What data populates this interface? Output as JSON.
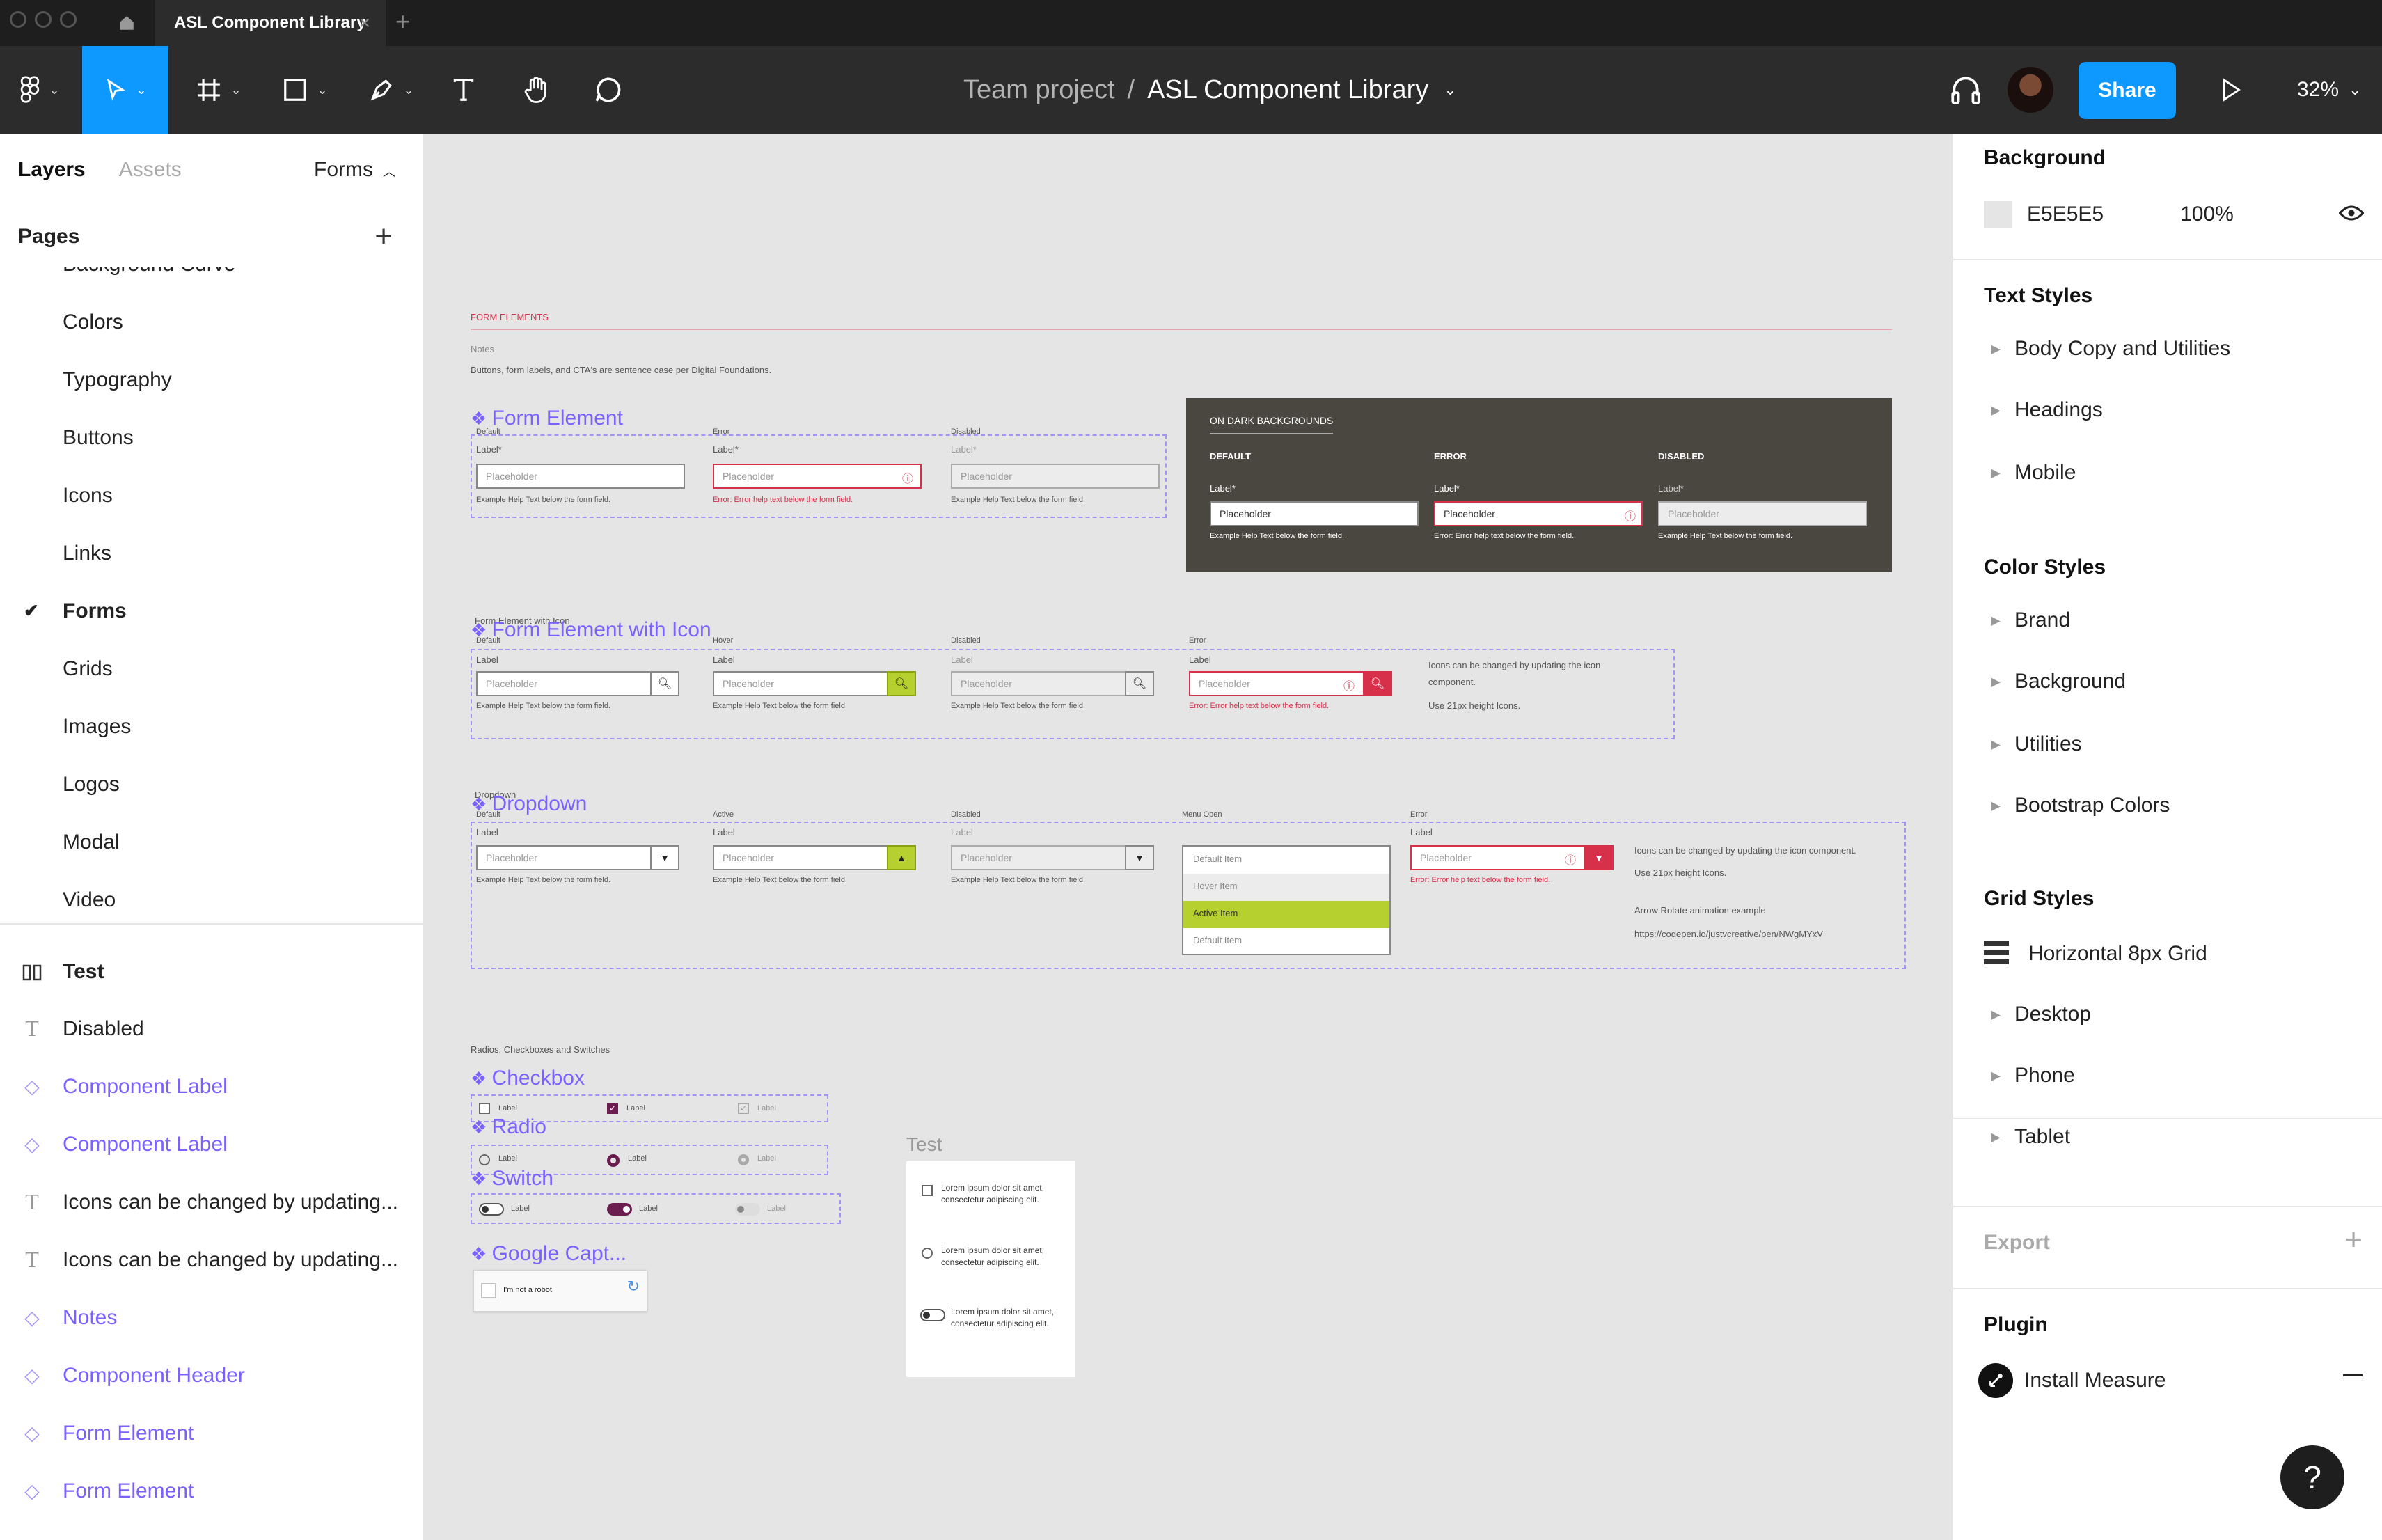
{
  "window": {
    "tab_title": "ASL Component Library",
    "tab_close": "×",
    "new_tab": "+"
  },
  "toolbar": {
    "project": "Team project",
    "separator": "/",
    "file_name": "ASL Component Library",
    "share_label": "Share",
    "zoom": "32%"
  },
  "left_panel": {
    "tab_layers": "Layers",
    "tab_assets": "Assets",
    "current_page_menu": "Forms",
    "pages_header": "Pages",
    "pages": [
      "Background Curve",
      "Colors",
      "Typography",
      "Buttons",
      "Icons",
      "Links",
      "Forms",
      "Grids",
      "Images",
      "Logos",
      "Modal",
      "Video"
    ],
    "selected_page": "Forms",
    "layers": [
      {
        "label": "Test",
        "kind": "frame"
      },
      {
        "label": "Disabled",
        "kind": "text"
      },
      {
        "label": "Component Label",
        "kind": "component"
      },
      {
        "label": "Component Label",
        "kind": "component"
      },
      {
        "label": "Icons can be changed by updating...",
        "kind": "text"
      },
      {
        "label": "Icons can be changed by updating...",
        "kind": "text"
      },
      {
        "label": "Notes",
        "kind": "component"
      },
      {
        "label": "Component Header",
        "kind": "component"
      },
      {
        "label": "Form Element",
        "kind": "component"
      },
      {
        "label": "Form Element",
        "kind": "component"
      }
    ]
  },
  "right_panel": {
    "background_header": "Background",
    "background_hex": "E5E5E5",
    "background_opacity": "100%",
    "text_styles_header": "Text Styles",
    "text_styles": [
      "Body Copy and Utilities",
      "Headings",
      "Mobile"
    ],
    "color_styles_header": "Color Styles",
    "color_styles": [
      "Brand",
      "Background",
      "Utilities",
      "Bootstrap Colors"
    ],
    "grid_styles_header": "Grid Styles",
    "grid_styles": [
      "Horizontal 8px Grid",
      "Desktop",
      "Phone",
      "Tablet"
    ],
    "export_header": "Export",
    "plugin_header": "Plugin",
    "plugin_item": "Install Measure",
    "help": "?"
  },
  "canvas": {
    "section_title": "FORM ELEMENTS",
    "notes_label": "Notes",
    "notes_text": "Buttons, form labels, and CTA's are sentence case per Digital Foundations.",
    "form_element": {
      "title": "Form Element",
      "states": [
        "Default",
        "Error",
        "Disabled"
      ],
      "label": "Label*",
      "placeholder": "Placeholder",
      "help": "Example Help Text below the form field.",
      "error": "Error: Error help text below the form field."
    },
    "dark": {
      "title": "ON DARK BACKGROUNDS",
      "states": [
        "DEFAULT",
        "ERROR",
        "DISABLED"
      ],
      "label": "Label*",
      "placeholder": "Placeholder",
      "help": "Example Help Text below the form field.",
      "error": "Error: Error help text below the form field."
    },
    "form_icon": {
      "frame_label": "Form Element with Icon",
      "title": "Form Element with Icon",
      "states": [
        "Default",
        "Hover",
        "Disabled",
        "Error"
      ],
      "label": "Label",
      "placeholder": "Placeholder",
      "help": "Example Help Text below the form field.",
      "error": "Error: Error help text below the form field.",
      "note1": "Icons can be changed by updating the icon component.",
      "note2": "Use 21px height Icons."
    },
    "dropdown": {
      "frame_label": "Dropdown",
      "title": "Dropdown",
      "states": [
        "Default",
        "Active",
        "Disabled",
        "Menu Open",
        "Error"
      ],
      "label": "Label",
      "placeholder": "Placeholder",
      "help": "Example Help Text below the form field.",
      "error": "Error: Error help text below the form field.",
      "menu": [
        "Default Item",
        "Hover Item",
        "Active Item",
        "Default Item"
      ],
      "note1": "Icons can be changed by updating the icon component.",
      "note2": "Use 21px height Icons.",
      "note3": "Arrow Rotate animation example",
      "note4": "https://codepen.io/justvcreative/pen/NWgMYxV"
    },
    "radios_title": "Radios, Checkboxes and Switches",
    "checkbox_title": "Checkbox",
    "radio_title": "Radio",
    "switch_title": "Switch",
    "captcha_title": "Google Capt...",
    "captcha_text": "I'm not a robot",
    "control_label": "Label",
    "test_title": "Test",
    "test_lorem": "Lorem ipsum dolor sit amet, consectetur adipiscing elit."
  },
  "colors": {
    "accent": "#0D99FF",
    "component": "#7B61FF",
    "error": "#D6304A",
    "brand_green": "#B6D02F",
    "dark_bg": "#4A4740"
  }
}
